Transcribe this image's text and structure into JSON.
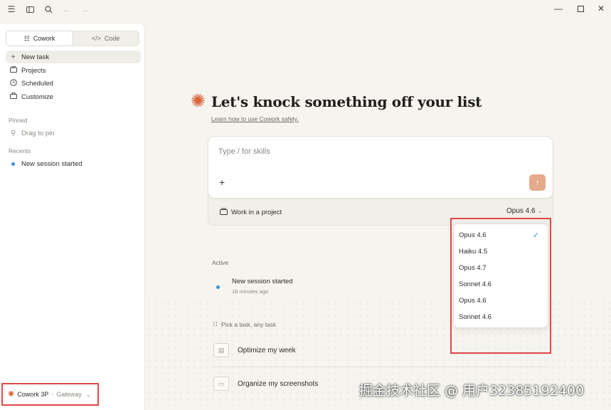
{
  "titlebar": {
    "icons": [
      "hamburger-menu-icon",
      "sidebar-toggle-icon",
      "search-icon",
      "back-arrow-icon",
      "forward-arrow-icon"
    ],
    "window_controls": [
      "minimize-icon",
      "maximize-icon",
      "close-icon"
    ]
  },
  "sidebar": {
    "modes": [
      {
        "label": "Cowork",
        "active": true
      },
      {
        "label": "Code",
        "active": false
      }
    ],
    "nav": [
      {
        "label": "New task",
        "icon": "plus-icon",
        "active": true
      },
      {
        "label": "Projects",
        "icon": "folder-icon"
      },
      {
        "label": "Scheduled",
        "icon": "clock-icon"
      },
      {
        "label": "Customize",
        "icon": "briefcase-icon"
      }
    ],
    "pinned_label": "Pinned",
    "pinned_hint": "Drag to pin",
    "recents_label": "Recents",
    "recents": [
      {
        "label": "New session started"
      }
    ],
    "account": {
      "name": "Cowork 3P",
      "separator": "·",
      "sub": "Gateway"
    }
  },
  "main": {
    "headline": "Let's knock something off your list",
    "learn_link": "Learn how to use Cowork safely",
    "learn_link_suffix": ".",
    "prompt": {
      "placeholder": "Type / for skills",
      "project_label": "Work in a project",
      "model": "Opus 4.6"
    },
    "active_label": "Active",
    "session": {
      "title": "New session started",
      "time": "18 minutes ago"
    },
    "pick_label": "Pick a task, any task",
    "tasks": [
      {
        "label": "Optimize my week"
      },
      {
        "label": "Organize my screenshots"
      }
    ]
  },
  "model_menu": {
    "items": [
      {
        "label": "Opus 4.6",
        "selected": true
      },
      {
        "label": "Haiku 4.5"
      },
      {
        "label": "Opus 4.7"
      },
      {
        "label": "Sonnet 4.6"
      },
      {
        "label": "Opus 4.6"
      },
      {
        "label": "Sonnet 4.6"
      }
    ]
  },
  "watermark": "掘金技术社区 @ 用户32385192400",
  "colors": {
    "accent": "#d9643a",
    "send_button": "#e5a98c",
    "highlight_box": "#e04848",
    "status_dot": "#3d8ed8"
  }
}
